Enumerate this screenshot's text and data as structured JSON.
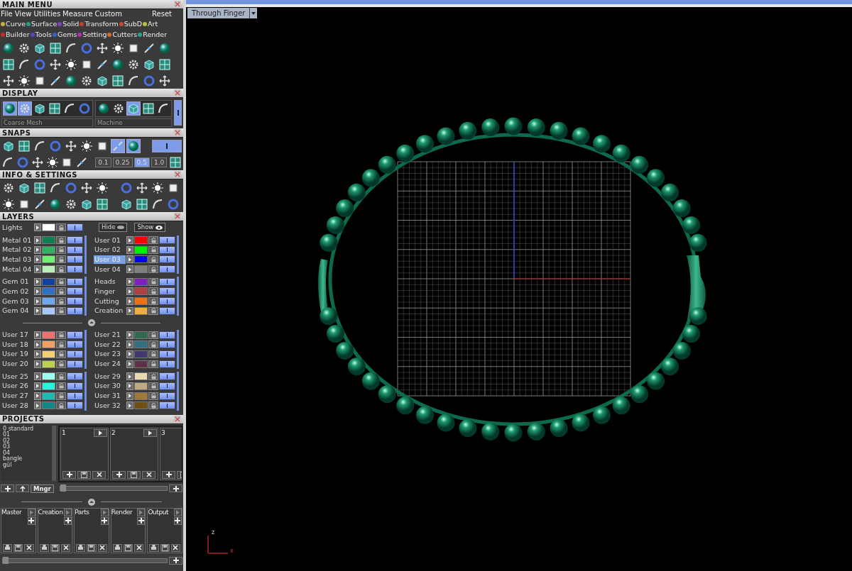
{
  "main_menu": {
    "title": "MAIN MENU",
    "menus": [
      "File",
      "View",
      "Utilities",
      "Measure",
      "Custom"
    ],
    "reset": "Reset",
    "categories": [
      {
        "label": "Curve",
        "color": "#c8b040"
      },
      {
        "label": "Surface",
        "color": "#2a9a80"
      },
      {
        "label": "Solid",
        "color": "#8040c0"
      },
      {
        "label": "Transform",
        "color": "#c04030"
      },
      {
        "label": "SubD",
        "color": "#c84830"
      },
      {
        "label": "Art",
        "color": "#b8c040"
      },
      {
        "label": "Builder",
        "color": "#c03030"
      },
      {
        "label": "Tools",
        "color": "#6040c0"
      },
      {
        "label": "Gems",
        "color": "#4060c0"
      },
      {
        "label": "Setting",
        "color": "#b030b0"
      },
      {
        "label": "Cutters",
        "color": "#d07030"
      },
      {
        "label": "Render",
        "color": "#30a090"
      }
    ]
  },
  "display": {
    "title": "DISPLAY",
    "view_buttons": [
      {
        "on": true
      },
      {
        "on": true
      },
      {
        "on": false
      },
      {
        "on": false
      },
      {
        "on": false
      },
      {
        "on": false
      }
    ],
    "shade_buttons": [
      {
        "on": false
      },
      {
        "on": false
      },
      {
        "on": true
      },
      {
        "on": false
      },
      {
        "on": false
      }
    ],
    "mesh": "Coarse Mesh",
    "material": "Machine"
  },
  "snaps": {
    "title": "SNAPS",
    "buttons": [
      {
        "on": false
      },
      {
        "on": false
      },
      {
        "on": false
      },
      {
        "on": false
      },
      {
        "on": false
      },
      {
        "on": false
      },
      {
        "on": false
      },
      {
        "on": true
      },
      {
        "on": true
      }
    ],
    "increments": [
      {
        "label": "0.1",
        "selected": false
      },
      {
        "label": "0.25",
        "selected": false
      },
      {
        "label": "0.5",
        "selected": true
      },
      {
        "label": "1.0",
        "selected": false
      }
    ]
  },
  "info_settings": {
    "title": "INFO & SETTINGS"
  },
  "layers": {
    "title": "LAYERS",
    "lights": {
      "name": "Lights",
      "color": "#ffffff",
      "selected": false,
      "visible": true
    },
    "hide": "Hide",
    "show": "Show",
    "sections": [
      [
        {
          "left": [
            {
              "name": "Metal 01",
              "color": "#108050",
              "selected": false,
              "visible": true
            },
            {
              "name": "Metal 02",
              "color": "#30b060",
              "selected": false,
              "visible": true
            },
            {
              "name": "Metal 03",
              "color": "#70f070",
              "selected": false,
              "visible": true
            },
            {
              "name": "Metal 04",
              "color": "#b8f0b8",
              "selected": false,
              "visible": true
            }
          ],
          "right": [
            {
              "name": "User 01",
              "color": "#ff0000",
              "selected": false,
              "visible": true
            },
            {
              "name": "User 02",
              "color": "#00ee00",
              "selected": false,
              "visible": true
            },
            {
              "name": "User 03",
              "color": "#0000ee",
              "selected": true,
              "visible": true
            },
            {
              "name": "User 04",
              "color": "#808080",
              "selected": false,
              "visible": true
            }
          ]
        },
        {
          "left": [
            {
              "name": "Gem 01",
              "color": "#1040a0",
              "selected": false,
              "visible": true
            },
            {
              "name": "Gem 02",
              "color": "#3070c0",
              "selected": false,
              "visible": true
            },
            {
              "name": "Gem 03",
              "color": "#70a8f0",
              "selected": false,
              "visible": true
            },
            {
              "name": "Gem 04",
              "color": "#a8c8f8",
              "selected": false,
              "visible": true
            }
          ],
          "right": [
            {
              "name": "Heads",
              "color": "#8020c0",
              "selected": false,
              "visible": true
            },
            {
              "name": "Finger",
              "color": "#b04040",
              "selected": false,
              "visible": true
            },
            {
              "name": "Cutting",
              "color": "#f07010",
              "selected": false,
              "visible": true
            },
            {
              "name": "Creation",
              "color": "#f0b030",
              "selected": false,
              "visible": true
            }
          ]
        }
      ],
      [
        {
          "left": [
            {
              "name": "User 17",
              "color": "#f07070",
              "selected": false,
              "visible": true
            },
            {
              "name": "User 18",
              "color": "#f0a060",
              "selected": false,
              "visible": true
            },
            {
              "name": "User 19",
              "color": "#f0d070",
              "selected": false,
              "visible": true
            },
            {
              "name": "User 20",
              "color": "#c0d050",
              "selected": false,
              "visible": true
            }
          ],
          "right": [
            {
              "name": "User 21",
              "color": "#306850",
              "selected": false,
              "visible": true
            },
            {
              "name": "User 22",
              "color": "#307080",
              "selected": false,
              "visible": true
            },
            {
              "name": "User 23",
              "color": "#403870",
              "selected": false,
              "visible": true
            },
            {
              "name": "User 24",
              "color": "#603048",
              "selected": false,
              "visible": true
            }
          ]
        },
        {
          "left": [
            {
              "name": "User 25",
              "color": "#a0fff0",
              "selected": false,
              "visible": true
            },
            {
              "name": "User 26",
              "color": "#30f0e0",
              "selected": false,
              "visible": true
            },
            {
              "name": "User 27",
              "color": "#20b8b0",
              "selected": false,
              "visible": true
            },
            {
              "name": "User 28",
              "color": "#108888",
              "selected": false,
              "visible": true
            }
          ],
          "right": [
            {
              "name": "User 29",
              "color": "#e8d8b0",
              "selected": false,
              "visible": true
            },
            {
              "name": "User 30",
              "color": "#c0a880",
              "selected": false,
              "visible": true
            },
            {
              "name": "User 31",
              "color": "#a07838",
              "selected": false,
              "visible": true
            },
            {
              "name": "User 32",
              "color": "#705010",
              "selected": false,
              "visible": true
            }
          ]
        }
      ]
    ]
  },
  "projects": {
    "title": "PROJECTS",
    "list": [
      "0 standard",
      "01",
      "02",
      "03",
      "04",
      "bangle",
      "gül"
    ],
    "manager": "Mngr",
    "slots": [
      "1",
      "2",
      "3"
    ],
    "slots_slider": {
      "level": 0
    },
    "groups_slider": {
      "level": 0
    },
    "groups": [
      "Master",
      "Creation",
      "Parts",
      "Render",
      "Output"
    ]
  },
  "viewport": {
    "view_menu": "Through Finger",
    "axis_z": "z",
    "axis_x": "x"
  }
}
